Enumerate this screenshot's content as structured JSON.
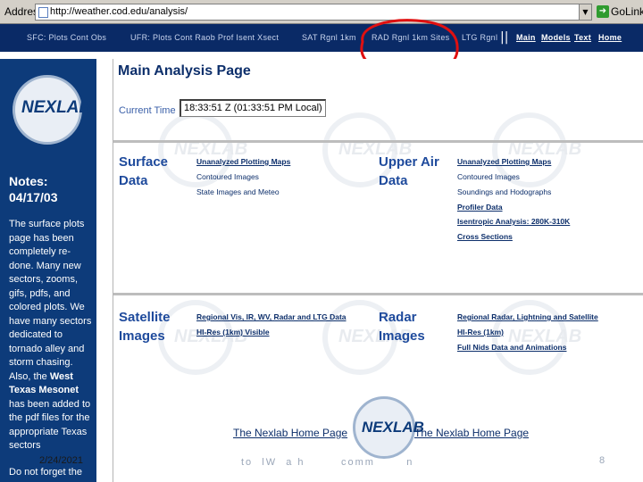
{
  "addressbar": {
    "label": "Address",
    "url": "http://weather.cod.edu/analysis/",
    "go_label": "Go",
    "links_label": "Links"
  },
  "topnav": {
    "items": [
      {
        "label": "SFC: Plots Cont Obs"
      },
      {
        "label": "UFR: Plots Cont Raob Prof Isent Xsect"
      },
      {
        "label": "SAT Rgnl 1km"
      },
      {
        "label": "RAD Rgnl 1km Sites"
      },
      {
        "label": "LTG Rgnl"
      }
    ],
    "links": [
      {
        "label": "Main"
      },
      {
        "label": "Models"
      },
      {
        "label": "Text"
      },
      {
        "label": "Home"
      }
    ],
    "separator": "||"
  },
  "sidebar": {
    "logo_text": "NEXLAB",
    "notes_title": "Notes:",
    "notes_date": "04/17/03",
    "notes_body_1": "The surface plots page has been completely re-done. Many new sectors, zooms, gifs, pdfs, and colored plots. We have many sectors dedicated to tornado alley and storm chasing. Also, the ",
    "notes_bold_1": "West Texas Mesonet",
    "notes_body_2": " has been added to the pdf files for the appropriate Texas sectors",
    "notes_footer": "Do not forget the"
  },
  "main": {
    "title": "Main Analysis Page",
    "time_label": "Current Time",
    "time_value": "18:33:51 Z (01:33:51 PM Local)",
    "surface": {
      "title_1": "Surface",
      "title_2": "Data",
      "links": [
        "Unanalyzed Plotting Maps",
        "Contoured Images",
        "State Images and Meteo"
      ]
    },
    "upper_air": {
      "title_1": "Upper Air",
      "title_2": "Data",
      "links": [
        "Unanalyzed Plotting Maps",
        "Contoured Images",
        "Soundings and Hodographs",
        "Profiler Data",
        "Isentropic Analysis: 280K-310K",
        "Cross Sections"
      ]
    },
    "satellite": {
      "title_1": "Satellite",
      "title_2": "Images",
      "links": [
        "Regional Vis, IR, WV, Radar and LTG Data",
        "HI-Res (1km) Visible"
      ]
    },
    "radar": {
      "title_1": "Radar",
      "title_2": "Images",
      "links": [
        "Regional Radar, Lightning and Satellite",
        "HI-Res (1km)",
        "Full Nids Data and Animations"
      ]
    },
    "home_link_left": "The Nexlab Home Page",
    "home_link_right": "The Nexlab Home Page",
    "bottom_logo_text": "NEXLAB"
  },
  "slide": {
    "date": "2/24/2021",
    "footer": "to  lW  a h        comm       n",
    "number": "8"
  },
  "colors": {
    "nav_bg": "#0a2a66",
    "sidebar_bg": "#0d3b7a",
    "annotation": "#e01010"
  }
}
